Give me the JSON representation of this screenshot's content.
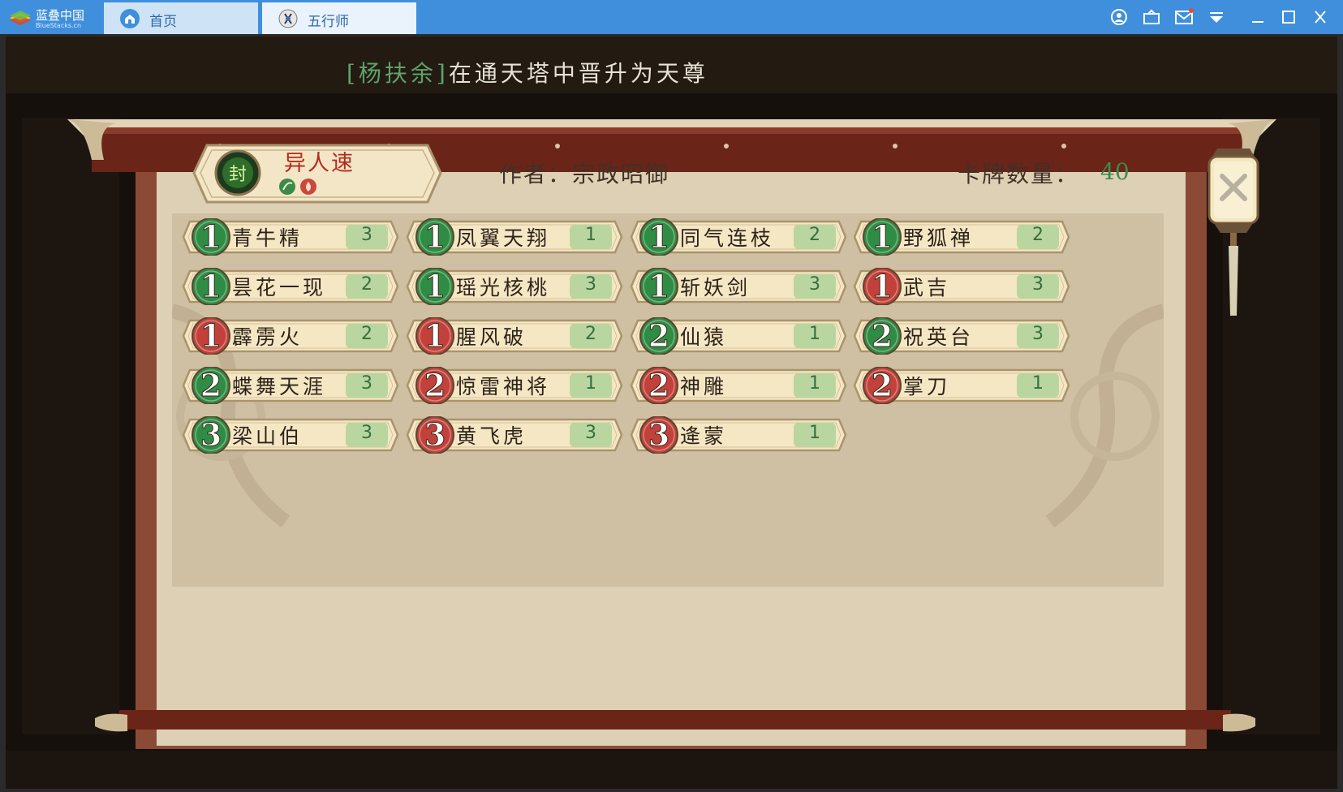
{
  "window": {
    "brand_name": "蓝叠中国",
    "brand_sub": "BlueStacks.cn",
    "tabs": [
      {
        "label": "首页",
        "icon": "home-icon",
        "active": false
      },
      {
        "label": "五行师",
        "icon": "game-app-icon",
        "active": true
      }
    ],
    "controls": [
      "account-icon",
      "share-icon",
      "mail-icon",
      "dropdown-menu-icon",
      "minimize-icon",
      "maximize-icon",
      "close-window-icon"
    ]
  },
  "game": {
    "marquee": {
      "name": "[杨扶余]",
      "message": "在通天塔中晋升为天尊"
    },
    "deck": {
      "name": "异人速",
      "element_icons": [
        "wood-element-icon",
        "fire-element-icon"
      ],
      "badge_icon": "seal-emblem-icon",
      "author_text": "作者：宗政昭御",
      "card_count_label": "卡牌数量：",
      "card_count_value": "40"
    },
    "cards": [
      {
        "cost": "1",
        "name": "青牛精",
        "qty": "3",
        "color": "green"
      },
      {
        "cost": "1",
        "name": "凤翼天翔",
        "qty": "1",
        "color": "green"
      },
      {
        "cost": "1",
        "name": "同气连枝",
        "qty": "2",
        "color": "green"
      },
      {
        "cost": "1",
        "name": "野狐禅",
        "qty": "2",
        "color": "green"
      },
      {
        "cost": "1",
        "name": "昙花一现",
        "qty": "2",
        "color": "green"
      },
      {
        "cost": "1",
        "name": "瑶光核桃",
        "qty": "3",
        "color": "green"
      },
      {
        "cost": "1",
        "name": "斩妖剑",
        "qty": "3",
        "color": "green"
      },
      {
        "cost": "1",
        "name": "武吉",
        "qty": "3",
        "color": "red"
      },
      {
        "cost": "1",
        "name": "霹雳火",
        "qty": "2",
        "color": "red"
      },
      {
        "cost": "1",
        "name": "腥风破",
        "qty": "2",
        "color": "red"
      },
      {
        "cost": "2",
        "name": "仙猿",
        "qty": "1",
        "color": "green"
      },
      {
        "cost": "2",
        "name": "祝英台",
        "qty": "3",
        "color": "green"
      },
      {
        "cost": "2",
        "name": "蝶舞天涯",
        "qty": "3",
        "color": "green"
      },
      {
        "cost": "2",
        "name": "惊雷神将",
        "qty": "1",
        "color": "red"
      },
      {
        "cost": "2",
        "name": "神雕",
        "qty": "1",
        "color": "red"
      },
      {
        "cost": "2",
        "name": "掌刀",
        "qty": "1",
        "color": "red"
      },
      {
        "cost": "3",
        "name": "梁山伯",
        "qty": "3",
        "color": "green"
      },
      {
        "cost": "3",
        "name": "黄飞虎",
        "qty": "3",
        "color": "red"
      },
      {
        "cost": "3",
        "name": "逄蒙",
        "qty": "1",
        "color": "red"
      }
    ],
    "close_icon": "close-lantern-icon"
  },
  "colors": {
    "titlebar": "#3f8fdc",
    "cost_green": "#2f8c44",
    "cost_red": "#c2413a",
    "qty_box": "#b9d6a0",
    "deck_name": "#b32c1f",
    "count_value": "#3c8a4c"
  }
}
